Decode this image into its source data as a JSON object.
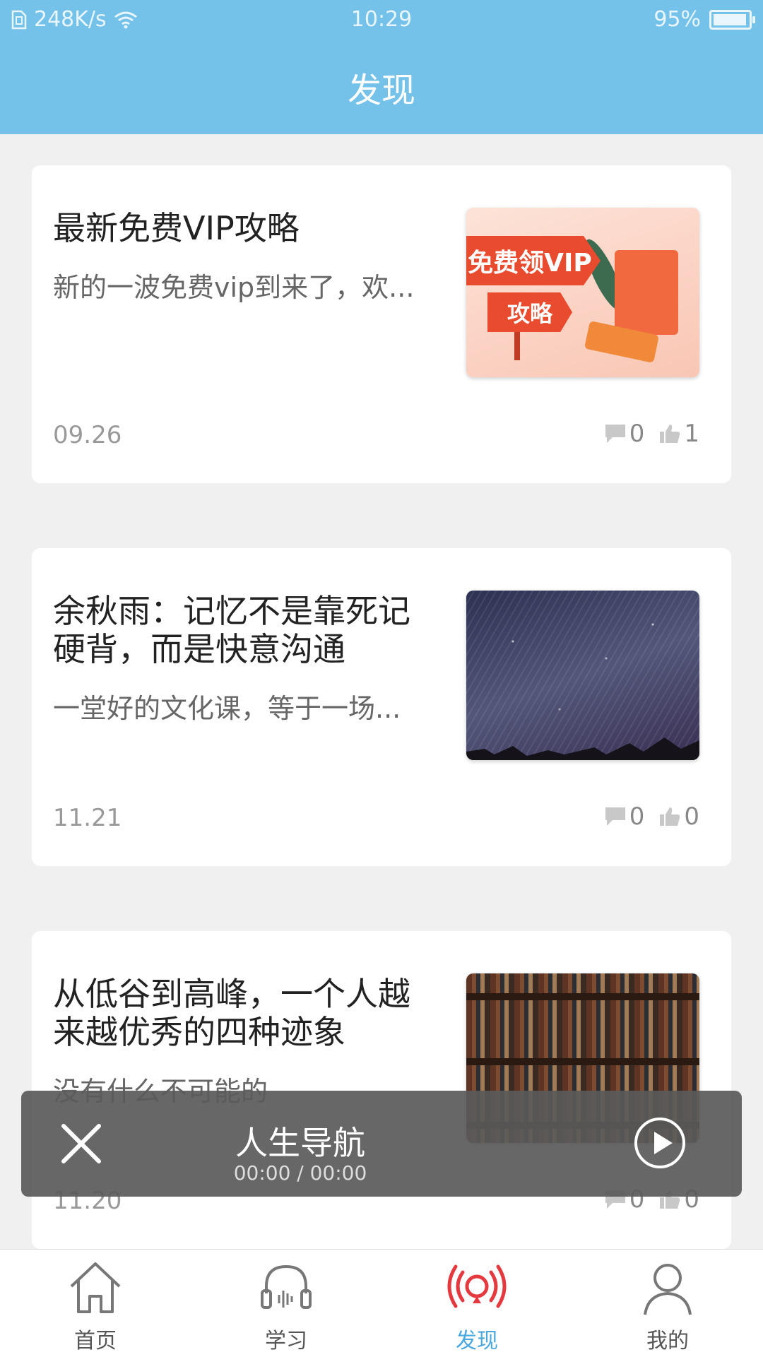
{
  "status_bar": {
    "network_speed": "248K/s",
    "time": "10:29",
    "battery": "95%",
    "battery_level": 0.95
  },
  "header": {
    "title": "发现"
  },
  "articles": [
    {
      "title": "最新免费VIP攻略",
      "summary": "新的一波免费vip到来了，欢...",
      "date": "09.26",
      "comments": "0",
      "likes": "1",
      "thumb_text_1": "免费领VIP",
      "thumb_text_2": "攻略"
    },
    {
      "title": "余秋雨：记忆不是靠死记硬背，而是快意沟通",
      "summary": "一堂好的文化课，等于一场...",
      "date": "11.21",
      "comments": "0",
      "likes": "0"
    },
    {
      "title": "从低谷到高峰，一个人越来越优秀的四种迹象",
      "summary": "没有什么不可能的",
      "date": "11.20",
      "comments": "0",
      "likes": "0"
    }
  ],
  "player": {
    "title": "人生导航",
    "time": "00:00 / 00:00"
  },
  "tabbar": {
    "items": [
      {
        "label": "首页",
        "icon": "home-icon"
      },
      {
        "label": "学习",
        "icon": "headphones-icon"
      },
      {
        "label": "发现",
        "icon": "broadcast-icon",
        "active": true
      },
      {
        "label": "我的",
        "icon": "person-icon"
      }
    ]
  },
  "colors": {
    "header": "#74c2ea",
    "active_tab": "#4aa8df",
    "active_icon": "#e53940"
  }
}
